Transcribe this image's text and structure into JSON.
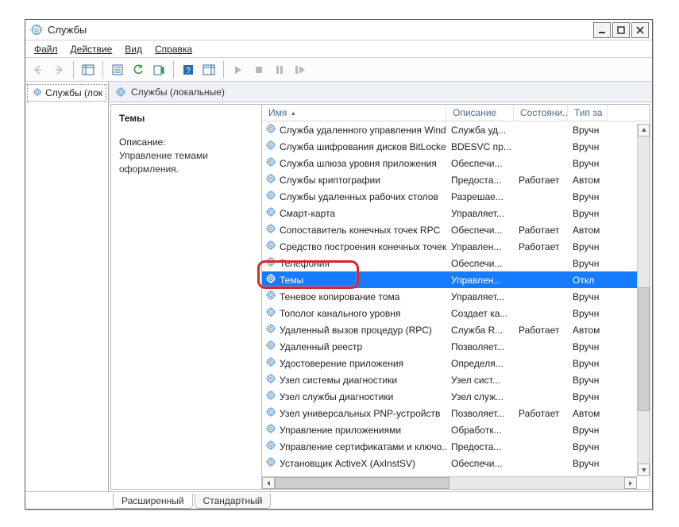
{
  "window": {
    "title": "Службы"
  },
  "menus": {
    "file": "Файл",
    "action": "Действие",
    "view": "Вид",
    "help": "Справка"
  },
  "tree": {
    "root_label": "Службы (лок"
  },
  "panel": {
    "header": "Службы (локальные)"
  },
  "desc": {
    "selected_name": "Темы",
    "label": "Описание:",
    "text": "Управление темами оформления."
  },
  "columns": {
    "name": "Имя",
    "desc": "Описание",
    "status": "Состояни...",
    "type": "Тип за"
  },
  "services": [
    {
      "name": "Служба удаленного управления Wind...",
      "desc": "Служба уд...",
      "status": "",
      "type": "Вручн"
    },
    {
      "name": "Служба шифрования дисков BitLocker",
      "desc": "BDESVC пр...",
      "status": "",
      "type": "Вручн"
    },
    {
      "name": "Служба шлюза уровня приложения",
      "desc": "Обеспечи...",
      "status": "",
      "type": "Вручн"
    },
    {
      "name": "Службы криптографии",
      "desc": "Предоста...",
      "status": "Работает",
      "type": "Автом"
    },
    {
      "name": "Службы удаленных рабочих столов",
      "desc": "Разрешае...",
      "status": "",
      "type": "Вручн"
    },
    {
      "name": "Смарт-карта",
      "desc": "Управляет...",
      "status": "",
      "type": "Вручн"
    },
    {
      "name": "Сопоставитель конечных точек RPC",
      "desc": "Обеспечи...",
      "status": "Работает",
      "type": "Автом"
    },
    {
      "name": "Средство построения конечных точек...",
      "desc": "Управлен...",
      "status": "Работает",
      "type": "Вручн"
    },
    {
      "name": "Телефония",
      "desc": "Обеспечи...",
      "status": "",
      "type": "Вручн"
    },
    {
      "name": "Темы",
      "desc": "Управлен...",
      "status": "",
      "type": "Откл"
    },
    {
      "name": "Теневое копирование тома",
      "desc": "Управляет...",
      "status": "",
      "type": "Вручн"
    },
    {
      "name": "Тополог канального уровня",
      "desc": "Создает ка...",
      "status": "",
      "type": "Вручн"
    },
    {
      "name": "Удаленный вызов процедур (RPC)",
      "desc": "Служба R...",
      "status": "Работает",
      "type": "Автом"
    },
    {
      "name": "Удаленный реестр",
      "desc": "Позволяет...",
      "status": "",
      "type": "Вручн"
    },
    {
      "name": "Удостоверение приложения",
      "desc": "Определя...",
      "status": "",
      "type": "Вручн"
    },
    {
      "name": "Узел системы диагностики",
      "desc": "Узел сист...",
      "status": "",
      "type": "Вручн"
    },
    {
      "name": "Узел службы диагностики",
      "desc": "Узел служ...",
      "status": "",
      "type": "Вручн"
    },
    {
      "name": "Узел универсальных PNP-устройств",
      "desc": "Позволяет...",
      "status": "Работает",
      "type": "Автом"
    },
    {
      "name": "Управление приложениями",
      "desc": "Обработк...",
      "status": "",
      "type": "Вручн"
    },
    {
      "name": "Управление сертификатами и ключо...",
      "desc": "Предоста...",
      "status": "",
      "type": "Вручн"
    },
    {
      "name": "Установщик ActiveX (AxInstSV)",
      "desc": "Обеспечи...",
      "status": "",
      "type": "Вручн"
    }
  ],
  "selected_index": 9,
  "tabs": {
    "extended": "Расширенный",
    "standard": "Стандартный"
  }
}
